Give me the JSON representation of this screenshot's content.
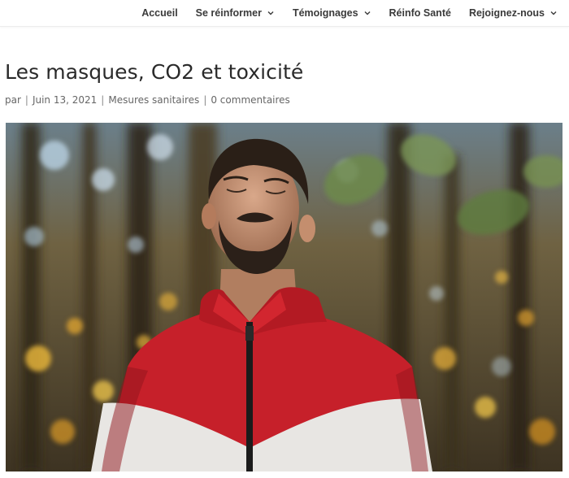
{
  "nav": {
    "items": [
      {
        "label": "Accueil",
        "has_dropdown": false
      },
      {
        "label": "Se réinformer",
        "has_dropdown": true
      },
      {
        "label": "Témoignages",
        "has_dropdown": true
      },
      {
        "label": "Réinfo Santé",
        "has_dropdown": false
      },
      {
        "label": "Rejoignez-nous",
        "has_dropdown": true
      }
    ]
  },
  "post": {
    "title": "Les masques, CO2 et toxicité",
    "meta": {
      "author_prefix": "par",
      "date": "Juin 13, 2021",
      "category": "Mesures sanitaires",
      "comments": "0 commentaires"
    }
  },
  "colors": {
    "text_dark": "#2a2a2a",
    "meta_text": "#666666",
    "jacket_red": "#c6202a",
    "jacket_white": "#e8e6e3"
  }
}
